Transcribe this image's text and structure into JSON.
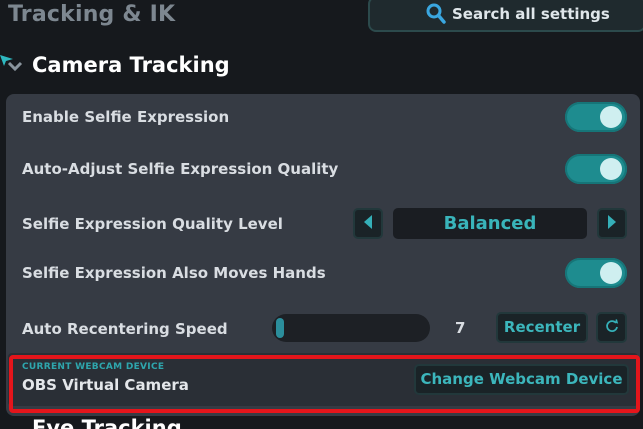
{
  "header": {
    "title": "Tracking & IK",
    "search_label": "Search all settings",
    "search_icon": "magnifier"
  },
  "section": {
    "title": "Camera Tracking"
  },
  "rows": {
    "enable_selfie": {
      "label": "Enable Selfie Expression",
      "enabled": true
    },
    "auto_adjust": {
      "label": "Auto-Adjust Selfie Expression Quality",
      "enabled": true
    },
    "quality_level": {
      "label": "Selfie Expression Quality Level",
      "value": "Balanced"
    },
    "moves_hands": {
      "label": "Selfie Expression Also Moves Hands",
      "enabled": true
    },
    "recenter_speed": {
      "label": "Auto Recentering Speed",
      "value": "7",
      "recenter_label": "Recenter"
    }
  },
  "webcam": {
    "caption": "CURRENT WEBCAM DEVICE",
    "device_name": "OBS Virtual Camera",
    "change_label": "Change Webcam Device"
  },
  "next_section": {
    "title": "Eye Tracking"
  },
  "colors": {
    "accent": "#1e8c8f",
    "accent_text": "#39b4ba",
    "panel": "#363b44",
    "background": "#16191d",
    "highlight": "#e4151b"
  }
}
